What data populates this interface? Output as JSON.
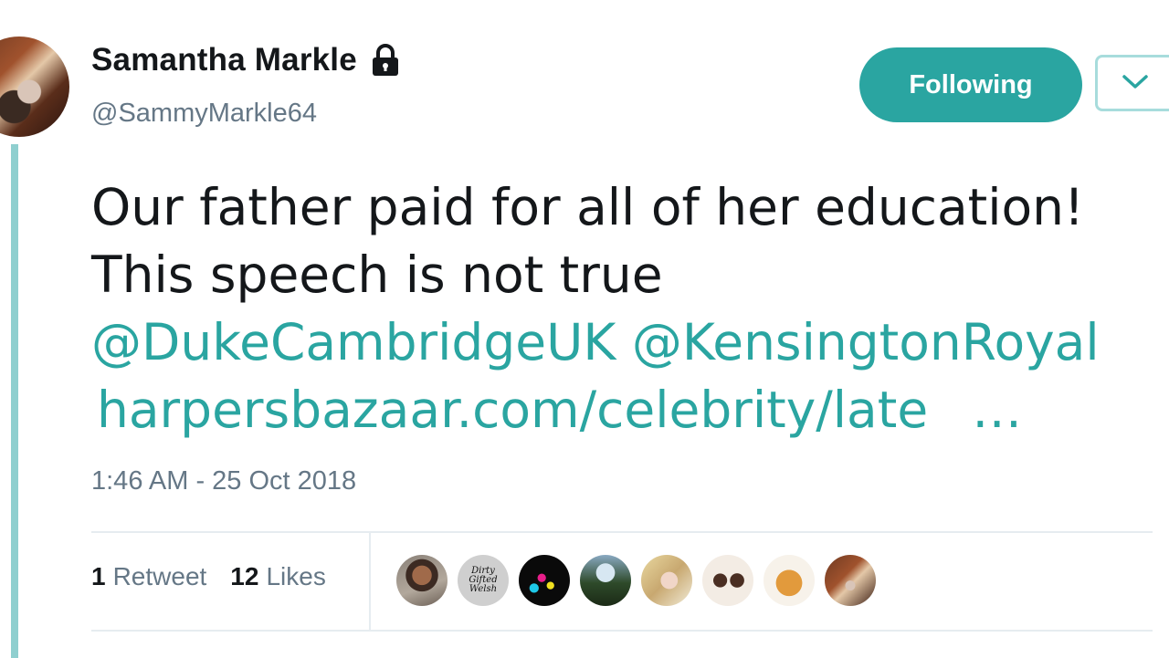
{
  "user": {
    "display_name": "Samantha Markle",
    "handle": "@SammyMarkle64",
    "protected_icon": "lock-icon"
  },
  "actions": {
    "follow_label": "Following",
    "dropdown_icon": "chevron-down-icon"
  },
  "tweet": {
    "line1": "Our father paid for all of her education!",
    "line2": "This speech is not true",
    "mention1": "@DukeCambridgeUK",
    "mention2": "@KensingtonRoyal",
    "link": "harpersbazaar.com/celebrity/late",
    "ellipsis": "…"
  },
  "timestamp": "1:46 AM - 25 Oct 2018",
  "stats": {
    "retweets_count": "1",
    "retweets_label": "Retweet",
    "likes_count": "12",
    "likes_label": "Likes"
  },
  "likers": [
    {
      "name": "liker-avatar-1"
    },
    {
      "name": "liker-avatar-2",
      "text": "Dirty Gifted Welsh"
    },
    {
      "name": "liker-avatar-3"
    },
    {
      "name": "liker-avatar-4"
    },
    {
      "name": "liker-avatar-5"
    },
    {
      "name": "liker-avatar-6"
    },
    {
      "name": "liker-avatar-7"
    },
    {
      "name": "liker-avatar-8"
    }
  ],
  "colors": {
    "accent": "#2aa5a1",
    "text": "#14171a",
    "muted": "#657786",
    "thread_line": "#8fcfcf"
  }
}
